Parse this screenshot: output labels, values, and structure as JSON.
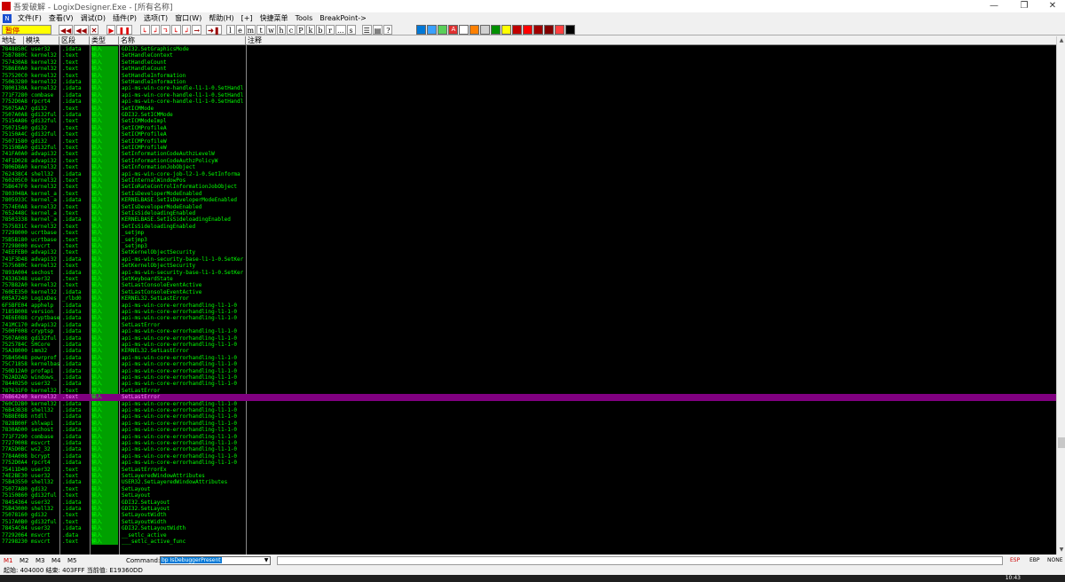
{
  "window": {
    "title": "吾爱破解 - LogixDesigner.Exe - [所有名称]",
    "controls": [
      "—",
      "❐",
      "✕"
    ]
  },
  "menu": {
    "icon_label": "N",
    "items": [
      "文件(F)",
      "查看(V)",
      "调试(D)",
      "插件(P)",
      "选项(T)",
      "窗口(W)",
      "帮助(H)",
      "[+]",
      "快捷菜单",
      "Tools",
      "BreakPoint->"
    ]
  },
  "toolbar": {
    "status": "暂停",
    "buttons_left": [
      "◀◀",
      "◀◀",
      "✕",
      "▶",
      "❚❚",
      "↳",
      "↲",
      "↴",
      "↳",
      "↲",
      "→",
      "➜❚"
    ],
    "letters": [
      "l",
      "e",
      "m",
      "t",
      "w",
      "h",
      "c",
      "P",
      "k",
      "b",
      "r",
      "...",
      "s"
    ],
    "icons_right": [
      "☰",
      "▤",
      "?"
    ],
    "color_buttons": [
      "#0078d7",
      "#3aa0ff",
      "#5ad05a",
      "#e03030",
      "#ffffff",
      "#ff8000",
      "#d0d0d0",
      "#009000",
      "#ffff00",
      "#c00000",
      "#ff0000",
      "#a00000",
      "#800000",
      "#ff4040",
      "#000000"
    ],
    "color_button_labels": [
      "",
      "",
      "",
      "A",
      "",
      "",
      "",
      "",
      "",
      "",
      "",
      "",
      "",
      "",
      ""
    ]
  },
  "columns": [
    "地址",
    "模块",
    "区段",
    "类型",
    "名称",
    "注释"
  ],
  "rows": [
    [
      "7848850C",
      "user32",
      ".idata",
      "输入",
      "GDI32.SetGraphicsMode"
    ],
    [
      "75B7880C",
      "kernel32",
      ".text",
      "输入",
      "SetHandleContext"
    ],
    [
      "757430A8",
      "kernel32",
      ".text",
      "输入",
      "SetHandleCount"
    ],
    [
      "75B6E0A0",
      "kernel32",
      ".text",
      "输入",
      "SetHandleCount"
    ],
    [
      "757520C0",
      "kernel32",
      ".text",
      "输入",
      "SetHandleInformation"
    ],
    [
      "75063280",
      "kernel32",
      ".idata",
      "输入",
      "SetHandleInformation"
    ],
    [
      "7800130A",
      "kernel32",
      ".idata",
      "输入",
      "api-ms-win-core-handle-l1-1-0.SetHandl"
    ],
    [
      "771F7280",
      "combase",
      ".idata",
      "输入",
      "api-ms-win-core-handle-l1-1-0.SetHandl"
    ],
    [
      "7752D0A8",
      "rpcrt4",
      ".idata",
      "输入",
      "api-ms-win-core-handle-l1-1-0.SetHandl"
    ],
    [
      "75075AA7",
      "gdi32",
      ".text",
      "输入",
      "SetICMMode"
    ],
    [
      "7507A0A8",
      "gdi32ful",
      ".idata",
      "输入",
      "GDI32.SetICMMode"
    ],
    [
      "75154A86",
      "gdi32ful",
      ".text",
      "输入",
      "SetICMModeImpl"
    ],
    [
      "75071540",
      "gdi32",
      ".text",
      "输入",
      "SetICMProfileA"
    ],
    [
      "75150A4C",
      "gdi32ful",
      ".text",
      "输入",
      "SetICMProfileA"
    ],
    [
      "75071580",
      "gdi32",
      ".text",
      "输入",
      "SetICMProfileW"
    ],
    [
      "75150BA0",
      "gdi32ful",
      ".text",
      "输入",
      "SetICMProfileW"
    ],
    [
      "741FA0A0",
      "advapi32",
      ".text",
      "输入",
      "SetInformationCodeAuthzLevelW"
    ],
    [
      "74F1D028",
      "advapi32",
      ".text",
      "输入",
      "SetInformationCodeAuthzPolicyW"
    ],
    [
      "7806D8A0",
      "kernel32",
      ".text",
      "输入",
      "SetInformationJobObject"
    ],
    [
      "762438C4",
      "shell32",
      ".idata",
      "输入",
      "api-ms-win-core-job-l2-1-0.SetInforma"
    ],
    [
      "760205C0",
      "kernel32",
      ".text",
      "输入",
      "SetInternalWindowPos"
    ],
    [
      "75B647F0",
      "kernel32",
      ".text",
      "输入",
      "SetIoRateControlInformationJobObject"
    ],
    [
      "7803048A",
      "kernel_a",
      ".text",
      "输入",
      "SetIsDeveloperModeEnabled"
    ],
    [
      "7805933C",
      "kernel_a",
      ".idata",
      "输入",
      "KERNELBASE.SetIsDeveloperModeEnabled"
    ],
    [
      "7574E0A8",
      "kernel32",
      ".text",
      "输入",
      "SetIsDeveloperModeEnabled"
    ],
    [
      "7652448C",
      "kernel_a",
      ".text",
      "输入",
      "SetIsSideloadingEnabled"
    ],
    [
      "78503338",
      "kernel_a",
      ".idata",
      "输入",
      "KERNELBASE.SetIsSideloadingEnabled"
    ],
    [
      "7575831C",
      "kernel32",
      ".text",
      "输入",
      "SetIsSideloadingEnabled"
    ],
    [
      "77298000",
      "ucrtbase",
      ".text",
      "输入",
      "_setjmp"
    ],
    [
      "75B5B180",
      "ucrtbase",
      ".text",
      "输入",
      "_setjmp3"
    ],
    [
      "77298000",
      "msvcrt",
      ".text",
      "输入",
      "_setjmp3"
    ],
    [
      "74EEFEB0",
      "advapi32",
      ".text",
      "输入",
      "SetKernelObjectSecurity"
    ],
    [
      "741F3D48",
      "advapi32",
      ".idata",
      "输入",
      "api-ms-win-security-base-l1-1-0.SetKer"
    ],
    [
      "7575680C",
      "kernel32",
      ".text",
      "输入",
      "SetKernelObjectSecurity"
    ],
    [
      "7893A004",
      "sechost",
      ".idata",
      "输入",
      "api-ms-win-security-base-l1-1-0.SetKer"
    ],
    [
      "74336348",
      "user32",
      ".text",
      "输入",
      "SetKeyboardState"
    ],
    [
      "757B82A0",
      "kernel32",
      ".text",
      "输入",
      "SetLastConsoleEventActive"
    ],
    [
      "760EE350",
      "kernel32",
      ".idata",
      "输入",
      "SetLastConsoleEventActive"
    ],
    [
      "005A7240",
      "LogixDes",
      "_rlbd0",
      "输入",
      "KERNEL32.SetLastError"
    ],
    [
      "6F5BFE04",
      "apphelp",
      ".idata",
      "输入",
      "api-ms-win-core-errorhandling-l1-1-0"
    ],
    [
      "7185B008",
      "version",
      ".idata",
      "输入",
      "api-ms-win-core-errorhandling-l1-1-0"
    ],
    [
      "74E6E088",
      "cryptbase",
      ".idata",
      "输入",
      "api-ms-win-core-errorhandling-l1-1-0"
    ],
    [
      "741MC170",
      "advapi32",
      ".idata",
      "输入",
      "SetLastError"
    ],
    [
      "7500F008",
      "cryptsp",
      ".idata",
      "输入",
      "api-ms-win-core-errorhandling-l1-1-0"
    ],
    [
      "7507A008",
      "gdi32ful",
      ".idata",
      "输入",
      "api-ms-win-core-errorhandling-l1-1-0"
    ],
    [
      "7525784C",
      "SHCore",
      ".idata",
      "输入",
      "api-ms-win-core-errorhandling-l1-1-0"
    ],
    [
      "75A38000",
      "imm32",
      ".idata",
      "输入",
      "KERNEL32.SetLastError"
    ],
    [
      "75B45048",
      "powrprof",
      ".idata",
      "输入",
      "api-ms-win-core-errorhandling-l1-1-0"
    ],
    [
      "75C71858",
      "kernelbase",
      ".idata",
      "输入",
      "api-ms-win-core-errorhandling-l1-1-0"
    ],
    [
      "750D12A0",
      "profapi",
      ".idata",
      "输入",
      "api-ms-win-core-errorhandling-l1-1-0"
    ],
    [
      "762AD2AD",
      "windows_",
      ".idata",
      "输入",
      "api-ms-win-core-errorhandling-l1-1-0"
    ],
    [
      "78440250",
      "user32",
      ".idata",
      "输入",
      "api-ms-win-core-errorhandling-l1-1-0"
    ],
    [
      "787631F0",
      "kernel32",
      ".text",
      "输入",
      "SetLastError"
    ],
    [
      "76B64240",
      "kernel32",
      ".text",
      "输入",
      "SetLastError"
    ],
    [
      "760CD2B0",
      "kernel32",
      ".idata",
      "输入",
      "api-ms-win-core-errorhandling-l1-1-0"
    ],
    [
      "76B43B38",
      "shell32",
      ".idata",
      "输入",
      "api-ms-win-core-errorhandling-l1-1-0"
    ],
    [
      "76B8E0B8",
      "ntdll",
      ".idata",
      "输入",
      "api-ms-win-core-errorhandling-l1-1-0"
    ],
    [
      "7828B00F",
      "shlwapi",
      ".idata",
      "输入",
      "api-ms-win-core-errorhandling-l1-1-0"
    ],
    [
      "7830AD00",
      "sechost",
      ".idata",
      "输入",
      "api-ms-win-core-errorhandling-l1-1-0"
    ],
    [
      "771F7290",
      "combase",
      ".idata",
      "输入",
      "api-ms-win-core-errorhandling-l1-1-0"
    ],
    [
      "77270008",
      "msvcrt",
      ".idata",
      "输入",
      "api-ms-win-core-errorhandling-l1-1-0"
    ],
    [
      "77A5D0BC",
      "ws2_32",
      ".idata",
      "输入",
      "api-ms-win-core-errorhandling-l1-1-0"
    ],
    [
      "7784A008",
      "bcrypt",
      ".idata",
      "输入",
      "api-ms-win-core-errorhandling-l1-1-0"
    ],
    [
      "7752D0A4",
      "rpcrt4",
      ".idata",
      "输入",
      "api-ms-win-core-errorhandling-l1-1-0"
    ],
    [
      "75411D40",
      "user32",
      ".text",
      "输入",
      "SetLastErrorEx"
    ],
    [
      "74E2BE30",
      "user32",
      ".text",
      "输入",
      "SetLayeredWindowAttributes"
    ],
    [
      "75B43550",
      "shell32",
      ".idata",
      "输入",
      "USER32.SetLayeredWindowAttributes"
    ],
    [
      "75077A80",
      "gdi32",
      ".text",
      "输入",
      "SetLayout"
    ],
    [
      "75150860",
      "gdi32ful",
      ".text",
      "输入",
      "SetLayout"
    ],
    [
      "78454364",
      "user32",
      ".idata",
      "输入",
      "GDI32.SetLayout"
    ],
    [
      "75B43000",
      "shell32",
      ".idata",
      "输入",
      "GDI32.SetLayout"
    ],
    [
      "75078160",
      "gdi32",
      ".text",
      "输入",
      "SetLayoutWidth"
    ],
    [
      "7517A0B0",
      "gdi32ful",
      ".text",
      "输入",
      "SetLayoutWidth"
    ],
    [
      "78454C04",
      "user32",
      ".idata",
      "输入",
      "GDI32.SetLayoutWidth"
    ],
    [
      "77292064",
      "msvcrt",
      ".data",
      "输入",
      "__setlc_active"
    ],
    [
      "77298230",
      "msvcrt",
      ".text",
      "输入",
      "___setlc_active_func"
    ]
  ],
  "selected_row_index": 53,
  "command": {
    "m_buttons": [
      "M1",
      "M2",
      "M3",
      "M4",
      "M5"
    ],
    "label": "Command:",
    "value": "bp IsDebuggerPresent",
    "flags": [
      "ESP",
      "EBP",
      "NONE"
    ]
  },
  "status": {
    "text": "起始: 404000 结束: 403FFF 当前值: E19360DD"
  },
  "taskbar": {
    "time": "10:43"
  }
}
